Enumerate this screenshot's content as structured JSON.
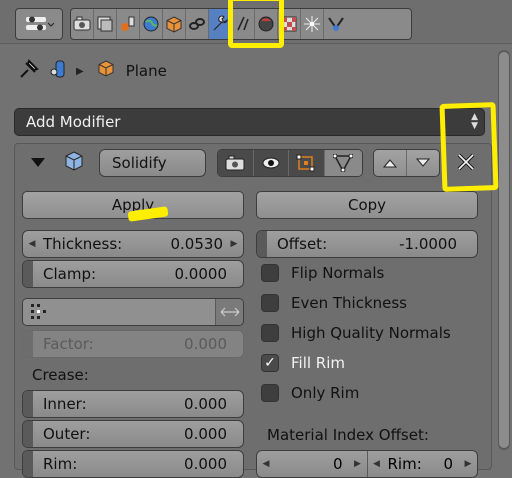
{
  "breadcrumb": {
    "object_name": "Plane"
  },
  "add_modifier": {
    "label": "Add Modifier"
  },
  "modifier": {
    "name": "Solidify",
    "apply_label": "Apply",
    "copy_label": "Copy",
    "thickness": {
      "label": "Thickness:",
      "value": "0.0530"
    },
    "offset": {
      "label": "Offset:",
      "value": "-1.0000"
    },
    "clamp": {
      "label": "Clamp:",
      "value": "0.0000"
    },
    "factor": {
      "label": "Factor:",
      "value": "0.000"
    },
    "crease_label": "Crease:",
    "inner": {
      "label": "Inner:",
      "value": "0.000"
    },
    "outer": {
      "label": "Outer:",
      "value": "0.000"
    },
    "rim": {
      "label": "Rim:",
      "value": "0.000"
    },
    "options": [
      {
        "label": "Flip Normals",
        "checked": false
      },
      {
        "label": "Even Thickness",
        "checked": false
      },
      {
        "label": "High Quality Normals",
        "checked": false
      },
      {
        "label": "Fill Rim",
        "checked": true
      },
      {
        "label": "Only Rim",
        "checked": false
      }
    ],
    "material_offset_label": "Material Index Offset:",
    "material_offset": {
      "value": "0"
    },
    "material_rim": {
      "label": "Rim:",
      "value": "0"
    }
  },
  "colors": {
    "highlight": "#ffee00",
    "active_tab": "#5680c2",
    "panel_bg": "#727272"
  },
  "icons": [
    "editor-type-icon",
    "render-icon",
    "render-layers-icon",
    "scene-icon",
    "world-icon",
    "object-icon",
    "constraints-icon",
    "modifiers-icon",
    "data-icon",
    "material-icon",
    "texture-icon",
    "particles-icon",
    "physics-icon",
    "pin-icon",
    "collapse-icon",
    "mesh-icon",
    "camera-icon",
    "eye-icon",
    "editmode-icon",
    "cage-icon",
    "move-up-icon",
    "move-down-icon",
    "close-icon",
    "vertex-group-icon",
    "swap-icon"
  ]
}
